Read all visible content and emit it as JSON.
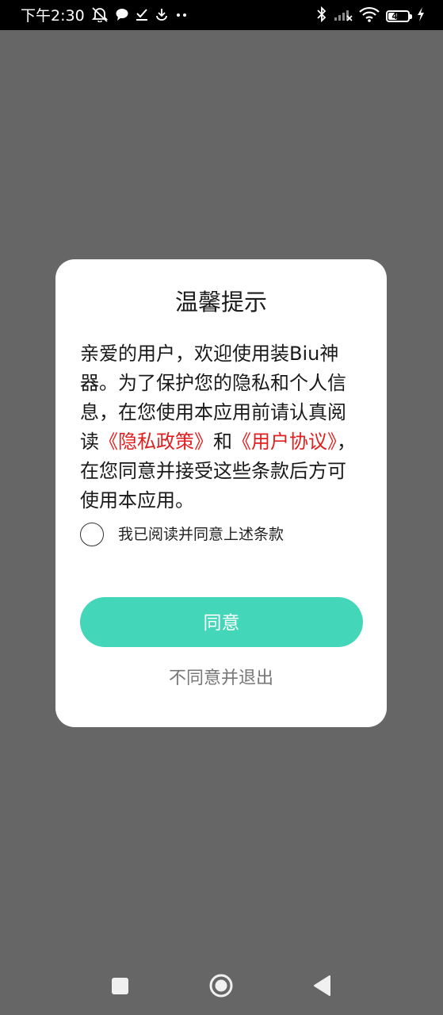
{
  "status_bar": {
    "time": "下午2:30",
    "battery_level": "46",
    "battery_fraction": 0.46
  },
  "dialog": {
    "title": "温馨提示",
    "body_intro": "亲爱的用户，欢迎使用装Biu神器。为了保护您的隐私和个人信息，在您使用本应用前请认真阅读",
    "privacy_link": "《隐私政策》",
    "connector": "和",
    "agreement_link": "《用户协议》",
    "body_outro": "，在您同意并接受这些条款后方可使用本应用。",
    "checkbox_label": "我已阅读并同意上述条款",
    "agree_button": "同意",
    "disagree_button": "不同意并退出"
  },
  "colors": {
    "accent": "#43d6b9",
    "link": "#e02020",
    "scrim": "#666666"
  },
  "icons": [
    "mute-icon",
    "message-icon",
    "task-icon",
    "download-icon",
    "more-icon",
    "bluetooth-icon",
    "signal-icon",
    "wifi-icon",
    "battery-icon",
    "charging-icon",
    "recents-icon",
    "home-icon",
    "back-icon"
  ]
}
